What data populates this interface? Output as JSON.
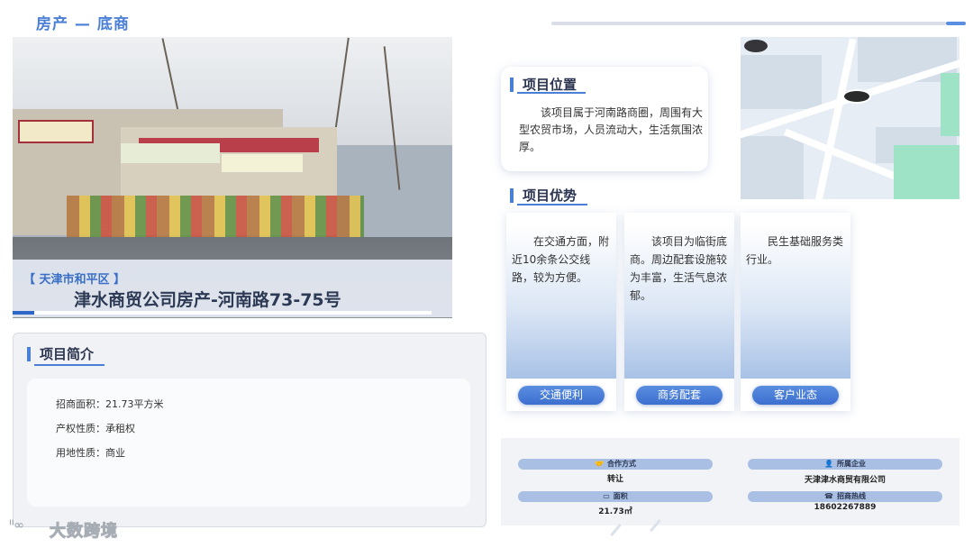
{
  "header": {
    "title": "房产 — 底商"
  },
  "hero": {
    "district": "【 天津市和平区 】",
    "project_name": "津水商贸公司房产-河南路73-75号"
  },
  "intro": {
    "section_title": "项目简介",
    "lines": [
      "招商面积：21.73平方米",
      "产权性质：承租权",
      "用地性质：商业"
    ]
  },
  "location": {
    "section_title": "项目位置",
    "text": "该项目属于河南路商圈，周围有大型农贸市场，人员流动大，生活氛围浓厚。"
  },
  "advantages": {
    "section_title": "项目优势",
    "cards": [
      {
        "text": "在交通方面，附近10余条公交线路，较为方便。",
        "tag": "交通便利"
      },
      {
        "text": "该项目为临街底商。周边配套设施较为丰富，生活气息浓郁。",
        "tag": "商务配套"
      },
      {
        "text": "民生基础服务类行业。",
        "tag": "客户业态"
      }
    ]
  },
  "info": {
    "cooperation": {
      "label": "合作方式",
      "value": "转让",
      "icon": "handshake-icon"
    },
    "company": {
      "label": "所属企业",
      "value": "天津津水商贸有限公司",
      "icon": "person-icon"
    },
    "area": {
      "label": "面积",
      "value": "21.73㎡",
      "icon": "area-icon"
    },
    "hotline": {
      "label": "招商热线",
      "value": "18602267889",
      "icon": "phone-icon"
    }
  },
  "footer": {
    "logo_text": "大数跨境"
  },
  "colors": {
    "accent": "#4a7fd6",
    "pill": "#3c6fcf",
    "info_pill": "#a9bfe4"
  }
}
